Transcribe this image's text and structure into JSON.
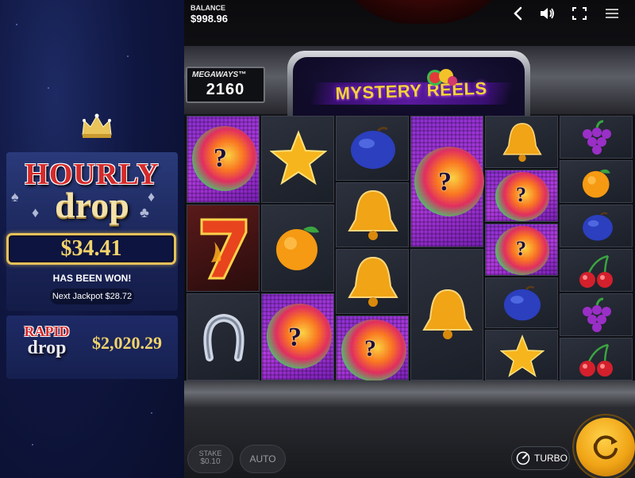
{
  "jackpots": {
    "hourly": {
      "title": "HOURLY",
      "subtitle": "drop",
      "amount": "$34.41",
      "status": "HAS BEEN WON!",
      "next_jackpot": "Next Jackpot $28.72"
    },
    "rapid": {
      "title": "RAPID",
      "subtitle": "drop",
      "amount": "$2,020.29"
    }
  },
  "header": {
    "balance_label": "BALANCE",
    "balance_value": "$998.96",
    "icons": [
      "back-icon",
      "volume-icon",
      "fullscreen-icon",
      "menu-icon"
    ]
  },
  "game": {
    "title": "MYSTERY REELS",
    "megaways_label": "MEGAWAYS™",
    "megaways_value": "2160",
    "reels": [
      [
        "mystery",
        "seven",
        "horseshoe"
      ],
      [
        "star",
        "orange",
        "mystery"
      ],
      [
        "plum",
        "bell",
        "bell",
        "mystery"
      ],
      [
        "mystery",
        "bell"
      ],
      [
        "bell",
        "mystery",
        "mystery",
        "plum",
        "star"
      ],
      [
        "grapes",
        "orange",
        "plum",
        "cherries",
        "grapes",
        "cherries"
      ]
    ],
    "mystery_symbol": "?"
  },
  "controls": {
    "stake_label": "STAKE",
    "stake_value": "$0.10",
    "auto_label": "AUTO",
    "turbo_label": "TURBO",
    "spin_icon": "spin-icon"
  },
  "colors": {
    "gold": "#f2d46b",
    "jackpot_red": "#d42a2a",
    "mystery_purple": "#b13ae0",
    "spin_orange": "#f0a416"
  }
}
